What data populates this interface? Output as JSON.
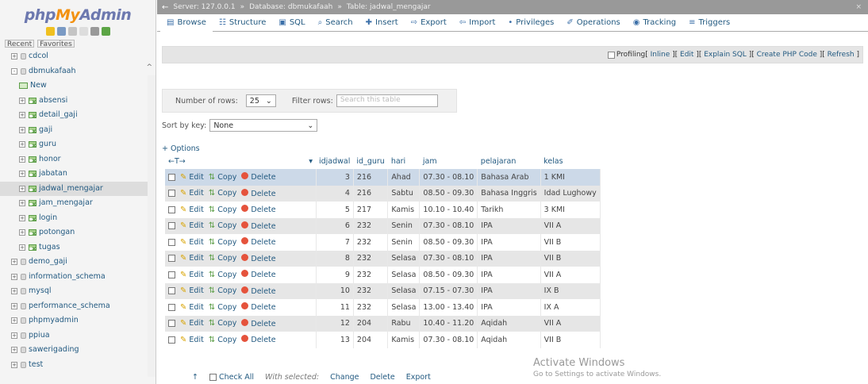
{
  "sidebar": {
    "logo": {
      "php": "php",
      "my": "My",
      "admin": "Admin"
    },
    "recent": "Recent",
    "favorites": "Favorites",
    "items": [
      {
        "label": "cdcol",
        "type": "db"
      },
      {
        "label": "dbmukafaah",
        "type": "db"
      },
      {
        "label": "New",
        "type": "new"
      },
      {
        "label": "absensi",
        "type": "table"
      },
      {
        "label": "detail_gaji",
        "type": "table"
      },
      {
        "label": "gaji",
        "type": "table"
      },
      {
        "label": "guru",
        "type": "table"
      },
      {
        "label": "honor",
        "type": "table"
      },
      {
        "label": "jabatan",
        "type": "table"
      },
      {
        "label": "jadwal_mengajar",
        "type": "table",
        "selected": true
      },
      {
        "label": "jam_mengajar",
        "type": "table"
      },
      {
        "label": "login",
        "type": "table"
      },
      {
        "label": "potongan",
        "type": "table"
      },
      {
        "label": "tugas",
        "type": "table"
      },
      {
        "label": "demo_gaji",
        "type": "db"
      },
      {
        "label": "information_schema",
        "type": "db"
      },
      {
        "label": "mysql",
        "type": "db"
      },
      {
        "label": "performance_schema",
        "type": "db"
      },
      {
        "label": "phpmyadmin",
        "type": "db"
      },
      {
        "label": "ppiua",
        "type": "db"
      },
      {
        "label": "sawerigading",
        "type": "db"
      },
      {
        "label": "test",
        "type": "db"
      }
    ]
  },
  "titlebar": {
    "server_label": "Server: 127.0.0.1",
    "database_label": "Database: dbmukafaah",
    "table_label": "Table: jadwal_mengajar"
  },
  "tabs": [
    "Browse",
    "Structure",
    "SQL",
    "Search",
    "Insert",
    "Export",
    "Import",
    "Privileges",
    "Operations",
    "Tracking",
    "Triggers"
  ],
  "profiling": {
    "label": "Profiling",
    "links": [
      "Inline",
      "Edit",
      "Explain SQL",
      "Create PHP Code",
      "Refresh"
    ]
  },
  "navigation": {
    "rows_label": "Number of rows:",
    "rows_value": "25",
    "filter_label": "Filter rows:",
    "filter_placeholder": "Search this table",
    "sort_label": "Sort by key:",
    "sort_value": "None",
    "options_label": "+ Options",
    "arrows_label": "←T→"
  },
  "table": {
    "columns": [
      "idjadwal",
      "id_guru",
      "hari",
      "jam",
      "pelajaran",
      "kelas"
    ],
    "action_labels": {
      "edit": "Edit",
      "copy": "Copy",
      "delete": "Delete"
    },
    "rows": [
      {
        "idjadwal": "3",
        "id_guru": "216",
        "hari": "Ahad",
        "jam": "07.30 - 08.10",
        "pelajaran": "Bahasa Arab",
        "kelas": "1 KMI"
      },
      {
        "idjadwal": "4",
        "id_guru": "216",
        "hari": "Sabtu",
        "jam": "08.50 - 09.30",
        "pelajaran": "Bahasa Inggris",
        "kelas": "Idad Lughowy"
      },
      {
        "idjadwal": "5",
        "id_guru": "217",
        "hari": "Kamis",
        "jam": "10.10 - 10.40",
        "pelajaran": "Tarikh",
        "kelas": "3 KMI"
      },
      {
        "idjadwal": "6",
        "id_guru": "232",
        "hari": "Senin",
        "jam": "07.30 - 08.10",
        "pelajaran": "IPA",
        "kelas": "VII A"
      },
      {
        "idjadwal": "7",
        "id_guru": "232",
        "hari": "Senin",
        "jam": "08.50 - 09.30",
        "pelajaran": "IPA",
        "kelas": "VII B"
      },
      {
        "idjadwal": "8",
        "id_guru": "232",
        "hari": "Selasa",
        "jam": "07.30 - 08.10",
        "pelajaran": "IPA",
        "kelas": "VII B"
      },
      {
        "idjadwal": "9",
        "id_guru": "232",
        "hari": "Selasa",
        "jam": "08.50 - 09.30",
        "pelajaran": "IPA",
        "kelas": "VII A"
      },
      {
        "idjadwal": "10",
        "id_guru": "232",
        "hari": "Selasa",
        "jam": "07.15 - 07.30",
        "pelajaran": "IPA",
        "kelas": "IX B"
      },
      {
        "idjadwal": "11",
        "id_guru": "232",
        "hari": "Selasa",
        "jam": "13.00 - 13.40",
        "pelajaran": "IPA",
        "kelas": "IX A"
      },
      {
        "idjadwal": "12",
        "id_guru": "204",
        "hari": "Rabu",
        "jam": "10.40 - 11.20",
        "pelajaran": "Aqidah",
        "kelas": "VII A"
      },
      {
        "idjadwal": "13",
        "id_guru": "204",
        "hari": "Kamis",
        "jam": "07.30 - 08.10",
        "pelajaran": "Aqidah",
        "kelas": "VII B"
      }
    ]
  },
  "bottom": {
    "check_all": "Check All",
    "with_selected": "With selected:",
    "change": "Change",
    "delete": "Delete",
    "export": "Export"
  },
  "watermark": {
    "title": "Activate Windows",
    "subtitle": "Go to Settings to activate Windows."
  }
}
